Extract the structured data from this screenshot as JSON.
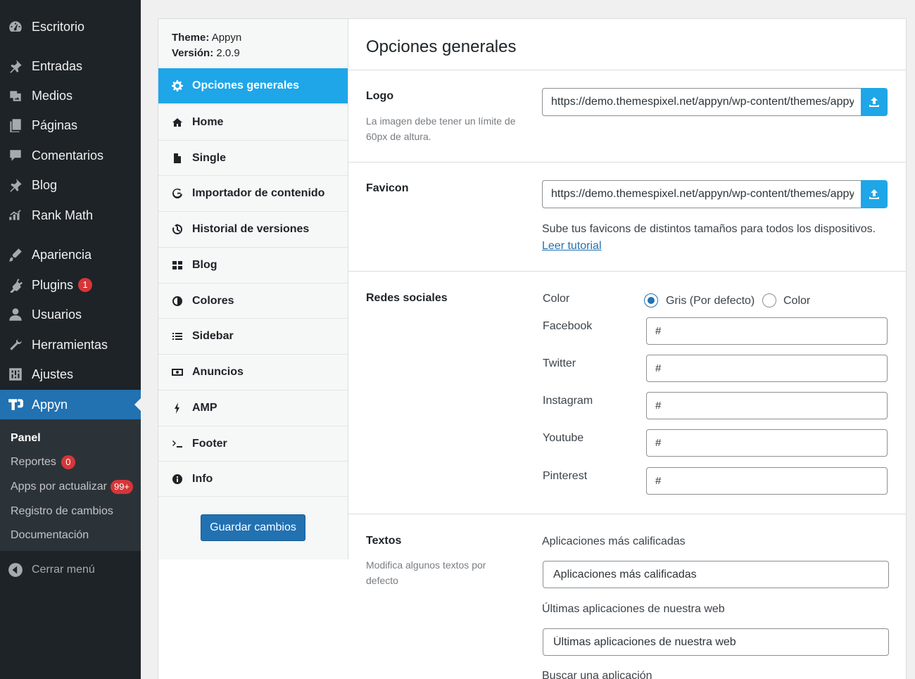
{
  "admin_menu": {
    "items": [
      {
        "label": "Escritorio",
        "icon": "dashboard-icon"
      },
      {
        "label": "Entradas",
        "icon": "pin-icon"
      },
      {
        "label": "Medios",
        "icon": "media-icon"
      },
      {
        "label": "Páginas",
        "icon": "pages-icon"
      },
      {
        "label": "Comentarios",
        "icon": "comments-icon"
      },
      {
        "label": "Blog",
        "icon": "pin-icon"
      },
      {
        "label": "Rank Math",
        "icon": "rank-math-icon"
      },
      {
        "label": "Apariencia",
        "icon": "appearance-icon"
      },
      {
        "label": "Plugins",
        "icon": "plugins-icon",
        "badge": "1"
      },
      {
        "label": "Usuarios",
        "icon": "users-icon"
      },
      {
        "label": "Herramientas",
        "icon": "tools-icon"
      },
      {
        "label": "Ajustes",
        "icon": "settings-icon"
      },
      {
        "label": "Appyn",
        "icon": "appyn-logo-icon"
      }
    ],
    "submenu": [
      {
        "label": "Panel"
      },
      {
        "label": "Reportes",
        "badge": "0"
      },
      {
        "label": "Apps por actualizar",
        "badge": "99+"
      },
      {
        "label": "Registro de cambios"
      },
      {
        "label": "Documentación"
      }
    ],
    "collapse_label": "Cerrar menú"
  },
  "theme_info": {
    "theme_key": "Theme:",
    "theme_value": "Appyn",
    "version_key": "Versión:",
    "version_value": "2.0.9"
  },
  "panel_nav": [
    {
      "label": "Opciones generales",
      "icon": "gear-icon"
    },
    {
      "label": "Home",
      "icon": "home-icon"
    },
    {
      "label": "Single",
      "icon": "file-icon"
    },
    {
      "label": "Importador de contenido",
      "icon": "google-icon"
    },
    {
      "label": "Historial de versiones",
      "icon": "history-icon"
    },
    {
      "label": "Blog",
      "icon": "grid-icon"
    },
    {
      "label": "Colores",
      "icon": "adjust-icon"
    },
    {
      "label": "Sidebar",
      "icon": "list-icon"
    },
    {
      "label": "Anuncios",
      "icon": "money-icon"
    },
    {
      "label": "AMP",
      "icon": "bolt-icon"
    },
    {
      "label": "Footer",
      "icon": "terminal-icon"
    },
    {
      "label": "Info",
      "icon": "info-icon"
    }
  ],
  "save_label": "Guardar cambios",
  "page_title": "Opciones generales",
  "logo": {
    "label": "Logo",
    "description": "La imagen debe tener un límite de 60px de altura.",
    "value": "https://demo.themespixel.net/appyn/wp-content/themes/appyn/images/logo.png"
  },
  "favicon": {
    "label": "Favicon",
    "value": "https://demo.themespixel.net/appyn/wp-content/themes/appyn/images/favicon.ico",
    "help": "Sube tus favicons de distintos tamaños para todos los dispositivos.",
    "link": "Leer tutorial"
  },
  "social": {
    "label": "Redes sociales",
    "color_label": "Color",
    "options": [
      "Gris (Por defecto)",
      "Color"
    ],
    "selected": 0,
    "fields": [
      {
        "label": "Facebook",
        "value": "#"
      },
      {
        "label": "Twitter",
        "value": "#"
      },
      {
        "label": "Instagram",
        "value": "#"
      },
      {
        "label": "Youtube",
        "value": "#"
      },
      {
        "label": "Pinterest",
        "value": "#"
      }
    ]
  },
  "texts": {
    "label": "Textos",
    "description": "Modifica algunos textos por defecto",
    "fields": [
      {
        "label": "Aplicaciones más calificadas",
        "value": "Aplicaciones más calificadas"
      },
      {
        "label": "Últimas aplicaciones de nuestra web",
        "value": "Últimas aplicaciones de nuestra web"
      },
      {
        "label": "Buscar una aplicación"
      }
    ]
  }
}
